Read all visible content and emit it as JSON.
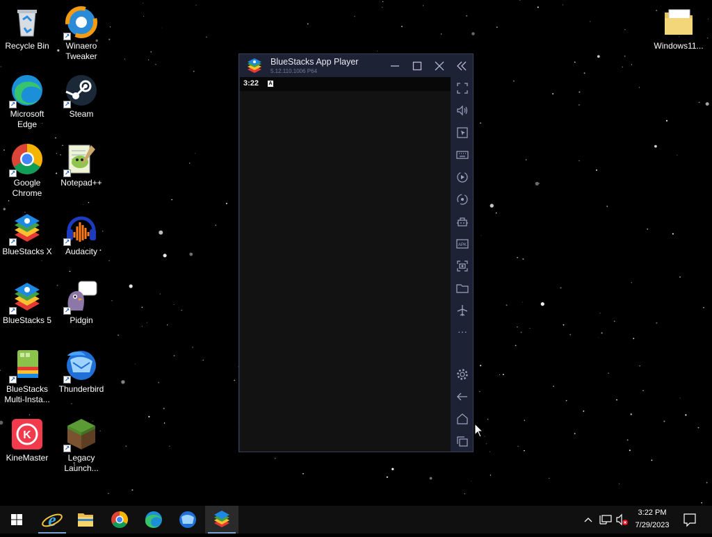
{
  "desktop_icons": {
    "recycle_bin": "Recycle Bin",
    "winaero": "Winaero Tweaker",
    "windows11": "Windows11...",
    "edge": "Microsoft Edge",
    "steam": "Steam",
    "chrome": "Google Chrome",
    "notepadpp": "Notepad++",
    "bluestacks_x": "BlueStacks X",
    "audacity": "Audacity",
    "bluestacks5": "BlueStacks 5",
    "pidgin": "Pidgin",
    "bluestacks_multi": "BlueStacks Multi-Insta...",
    "thunderbird": "Thunderbird",
    "kinemaster": "KineMaster",
    "legacy_launcher": "Legacy Launch..."
  },
  "bluestacks": {
    "title": "BlueStacks App Player",
    "version": "5.12.110.1006 P64",
    "status_time": "3:22",
    "notif_glyph": "A",
    "more_glyph": "···"
  },
  "taskbar": {
    "clock_time": "3:22 PM",
    "clock_date": "7/29/2023"
  },
  "colors": {
    "window_bg": "#1e2235",
    "screen_bg": "#121212",
    "taskbar_bg": "#101010"
  }
}
